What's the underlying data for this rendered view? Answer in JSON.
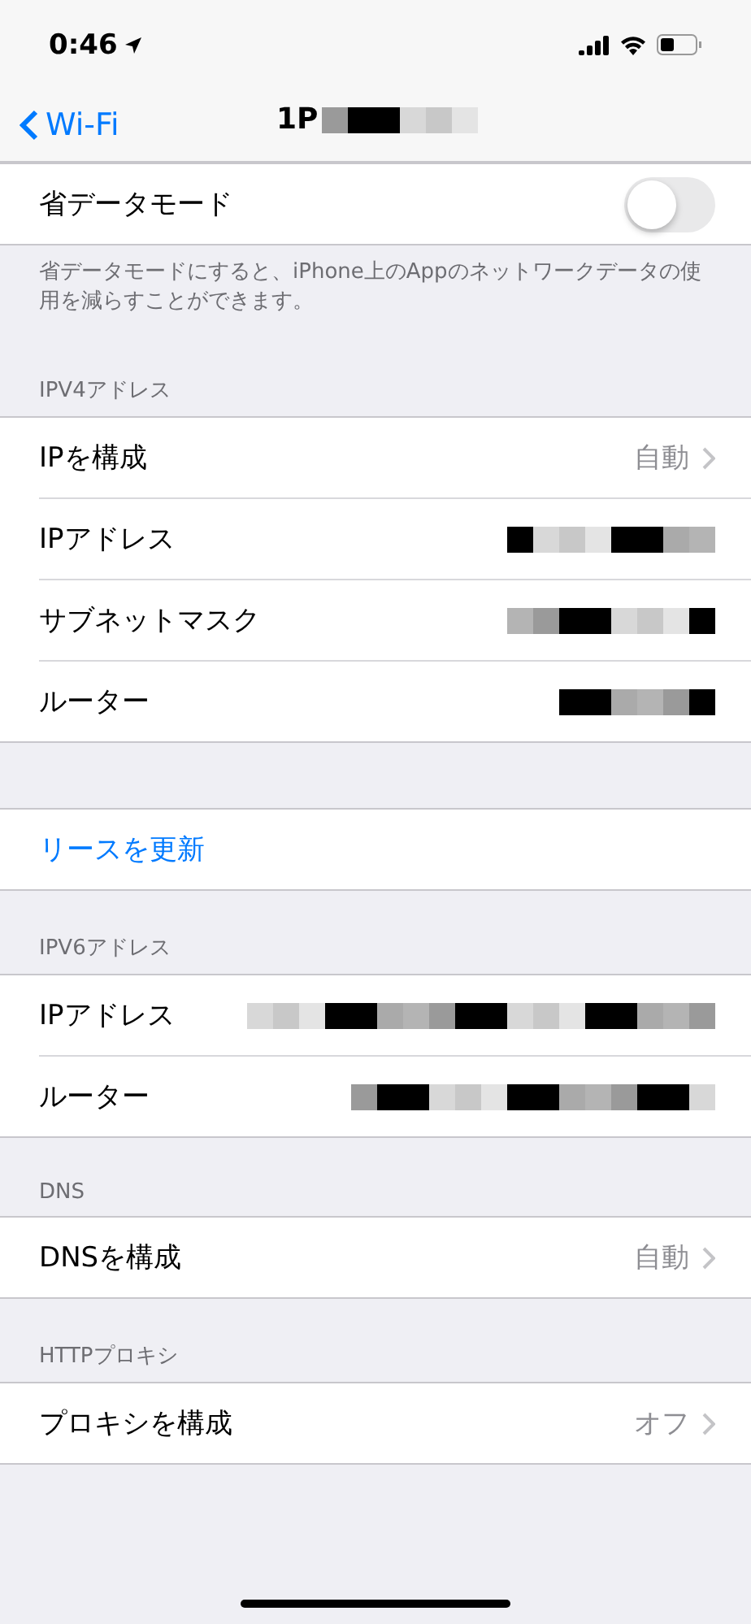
{
  "status_bar": {
    "time": "0:46"
  },
  "nav": {
    "back": "Wi-Fi",
    "title": "1P",
    "title_redacted": true
  },
  "sections": [
    {
      "rows": [
        {
          "kind": "toggle",
          "label": "省データモード",
          "on": false
        }
      ],
      "footer": "省データモードにすると、iPhone上のAppのネットワークデータの使用を減らすことができます。"
    },
    {
      "header": "IPV4アドレス",
      "rows": [
        {
          "kind": "value",
          "label": "IPを構成",
          "value": "自動"
        },
        {
          "kind": "redacted",
          "label": "IPアドレス"
        },
        {
          "kind": "redacted",
          "label": "サブネットマスク"
        },
        {
          "kind": "redacted",
          "label": "ルーター"
        }
      ]
    },
    {
      "rows": [
        {
          "kind": "action",
          "label": "リースを更新"
        }
      ]
    },
    {
      "header": "IPV6アドレス",
      "rows": [
        {
          "kind": "redacted",
          "label": "IPアドレス"
        },
        {
          "kind": "redacted",
          "label": "ルーター"
        }
      ]
    },
    {
      "header": "DNS",
      "rows": [
        {
          "kind": "value",
          "label": "DNSを構成",
          "value": "自動"
        }
      ]
    },
    {
      "header": "HTTPプロキシ",
      "rows": [
        {
          "kind": "value",
          "label": "プロキシを構成",
          "value": "オフ"
        }
      ]
    }
  ]
}
